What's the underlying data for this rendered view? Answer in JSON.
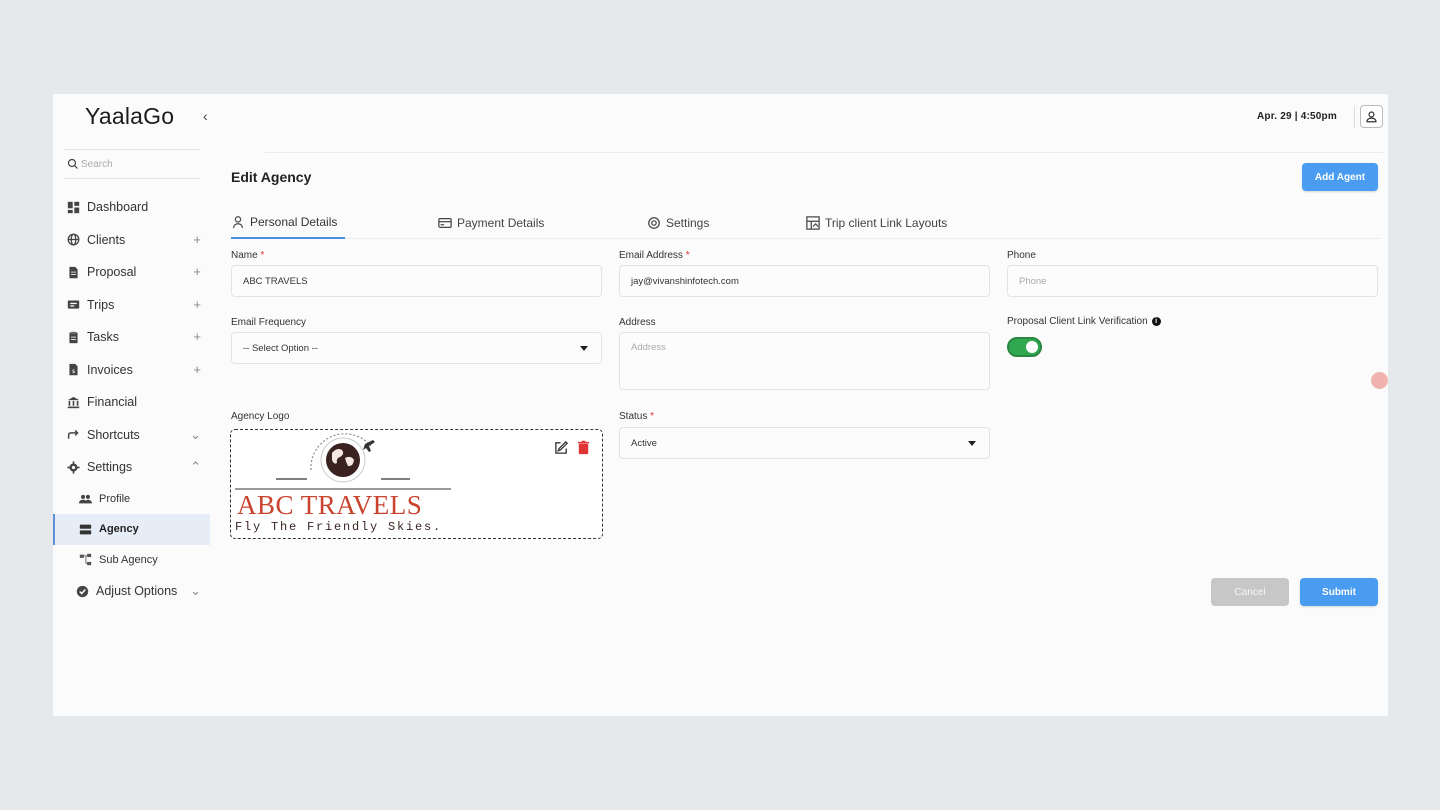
{
  "app": {
    "logo": "YaalaGo",
    "collapse_icon": "chevron-left-icon"
  },
  "search": {
    "placeholder": "Search"
  },
  "sidebar": {
    "items": [
      {
        "label": "Dashboard",
        "icon": "dashboard-icon",
        "right": ""
      },
      {
        "label": "Clients",
        "icon": "globe-icon",
        "right": "+"
      },
      {
        "label": "Proposal",
        "icon": "document-icon",
        "right": "+"
      },
      {
        "label": "Trips",
        "icon": "ticket-icon",
        "right": "+"
      },
      {
        "label": "Tasks",
        "icon": "clipboard-icon",
        "right": "+"
      },
      {
        "label": "Invoices",
        "icon": "invoice-icon",
        "right": "+"
      },
      {
        "label": "Financial",
        "icon": "bank-icon",
        "right": ""
      },
      {
        "label": "Shortcuts",
        "icon": "share-icon",
        "right": "⌄"
      },
      {
        "label": "Settings",
        "icon": "gear-icon",
        "right": "⌃"
      }
    ],
    "sub_items": [
      {
        "label": "Profile",
        "icon": "users-icon"
      },
      {
        "label": "Agency",
        "icon": "server-icon",
        "active": true
      },
      {
        "label": "Sub Agency",
        "icon": "hierarchy-icon"
      }
    ],
    "adjust": {
      "label": "Adjust Options",
      "right": "⌄"
    }
  },
  "topbar": {
    "date": "Apr. 29 | 4:50pm"
  },
  "page": {
    "title": "Edit Agency",
    "add_agent_label": "Add Agent"
  },
  "tabs": [
    {
      "label": "Personal Details",
      "active": true
    },
    {
      "label": "Payment Details"
    },
    {
      "label": "Settings"
    },
    {
      "label": "Trip client Link Layouts"
    }
  ],
  "form": {
    "name": {
      "label": "Name",
      "required": "*",
      "value": "ABC TRAVELS"
    },
    "email": {
      "label": "Email Address",
      "required": "*",
      "value": "jay@vivanshinfotech.com"
    },
    "phone": {
      "label": "Phone",
      "placeholder": "Phone"
    },
    "email_frequency": {
      "label": "Email Frequency",
      "value": "-- Select Option --"
    },
    "address": {
      "label": "Address",
      "placeholder": "Address"
    },
    "verification": {
      "label": "Proposal Client Link Verification",
      "info": "i",
      "enabled": true
    },
    "agency_logo": {
      "label": "Agency Logo",
      "logo_title": "ABC TRAVELS",
      "logo_tagline": "Fly The Friendly Skies."
    },
    "status": {
      "label": "Status",
      "required": "*",
      "value": "Active"
    }
  },
  "actions": {
    "cancel": "Cancel",
    "submit": "Submit"
  },
  "colors": {
    "primary": "#4a9cf0",
    "toggle_on": "#2fa84f",
    "logo_red": "#c9432f",
    "active_nav_bg": "#e7edf6"
  }
}
